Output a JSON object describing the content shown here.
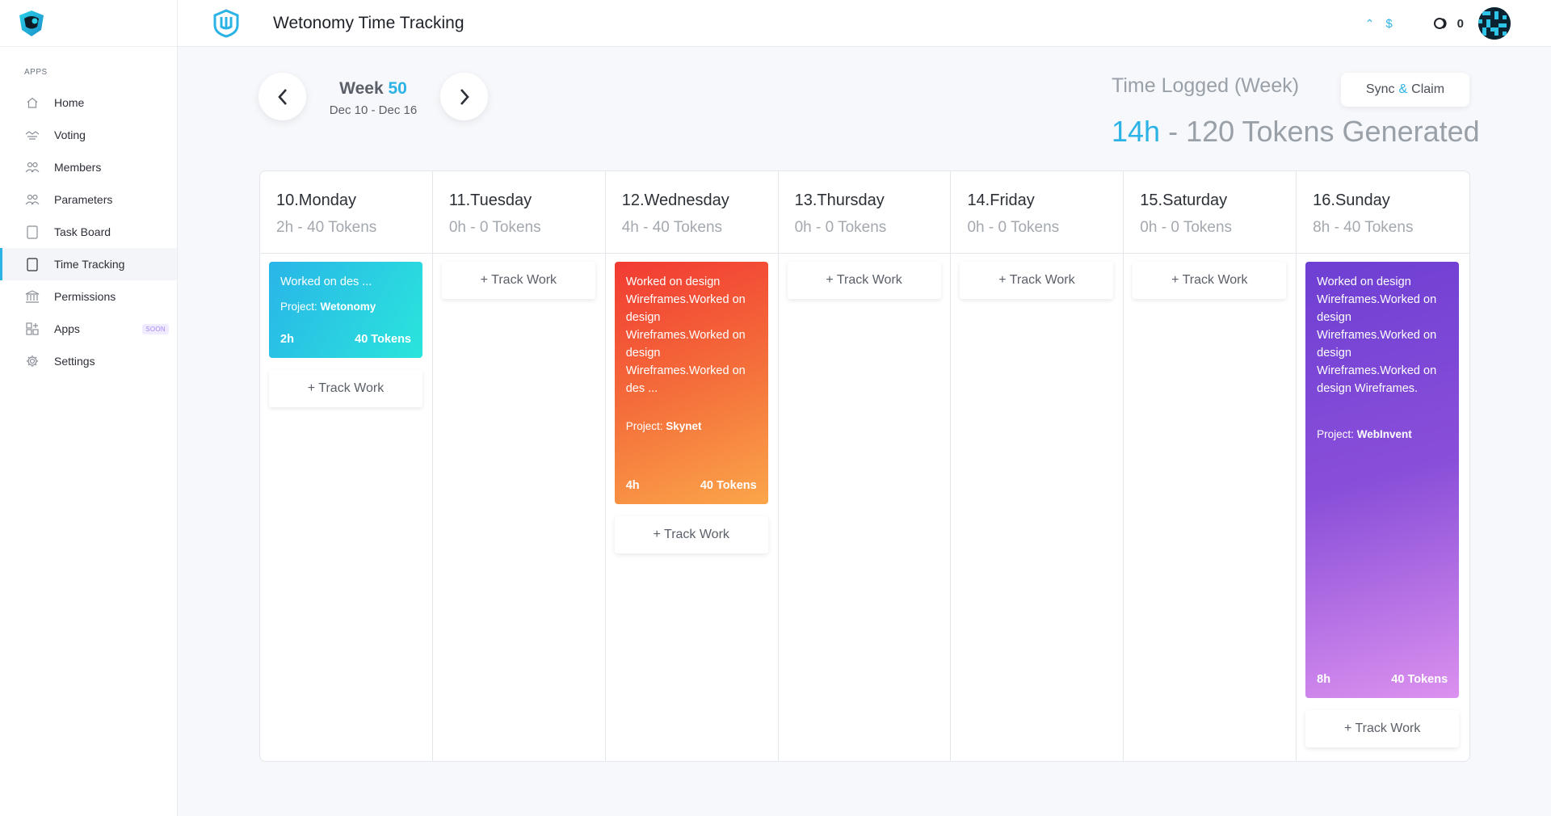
{
  "sidebar": {
    "section_label": "APPS",
    "items": [
      {
        "label": "Home",
        "icon": "home-icon"
      },
      {
        "label": "Voting",
        "icon": "voting-icon"
      },
      {
        "label": "Members",
        "icon": "members-icon"
      },
      {
        "label": "Parameters",
        "icon": "parameters-icon"
      },
      {
        "label": "Task Board",
        "icon": "task-board-icon"
      },
      {
        "label": "Time Tracking",
        "icon": "time-tracking-icon",
        "active": true
      },
      {
        "label": "Permissions",
        "icon": "permissions-icon"
      },
      {
        "label": "Apps",
        "icon": "apps-icon",
        "badge": "SOON"
      },
      {
        "label": "Settings",
        "icon": "settings-icon"
      }
    ]
  },
  "header": {
    "title": "Wetonomy Time Tracking",
    "currency_symbol": "$",
    "coin_count": "0"
  },
  "week": {
    "label": "Week",
    "number": "50",
    "range": "Dec 10 - Dec 16"
  },
  "summary": {
    "label": "Time Logged (Week)",
    "hours": "14h",
    "rest": " - 120 Tokens Generated",
    "sync_left": "Sync",
    "sync_amp": "&",
    "sync_right": "Claim"
  },
  "days": [
    {
      "name": "10.Monday",
      "summary": "2h - 40 Tokens"
    },
    {
      "name": "11.Tuesday",
      "summary": "0h - 0 Tokens"
    },
    {
      "name": "12.Wednesday",
      "summary": "4h - 40 Tokens"
    },
    {
      "name": "13.Thursday",
      "summary": "0h - 0 Tokens"
    },
    {
      "name": "14.Friday",
      "summary": "0h - 0 Tokens"
    },
    {
      "name": "15.Saturday",
      "summary": "0h - 0 Tokens"
    },
    {
      "name": "16.Sunday",
      "summary": "8h - 40 Tokens"
    }
  ],
  "entries": {
    "monday": {
      "description": "Worked on des ...",
      "project_label": "Project:",
      "project": "Wetonomy",
      "hours": "2h",
      "tokens": "40 Tokens"
    },
    "wednesday": {
      "description": "Worked on design Wireframes.Worked on design Wireframes.Worked on design Wireframes.Worked on des ...",
      "project_label": "Project:",
      "project": "Skynet",
      "hours": "4h",
      "tokens": "40 Tokens"
    },
    "sunday": {
      "description": "Worked on design Wireframes.Worked on design Wireframes.Worked on design Wireframes.Worked on design Wireframes.",
      "project_label": "Project:",
      "project": "WebInvent",
      "hours": "8h",
      "tokens": "40 Tokens"
    }
  },
  "track_work_label": "+ Track Work",
  "colors": {
    "accent": "#2bb3e6",
    "card_blue": "#29b5e8",
    "card_orange": "#f46d3a",
    "card_purple": "#8a4fd9"
  }
}
